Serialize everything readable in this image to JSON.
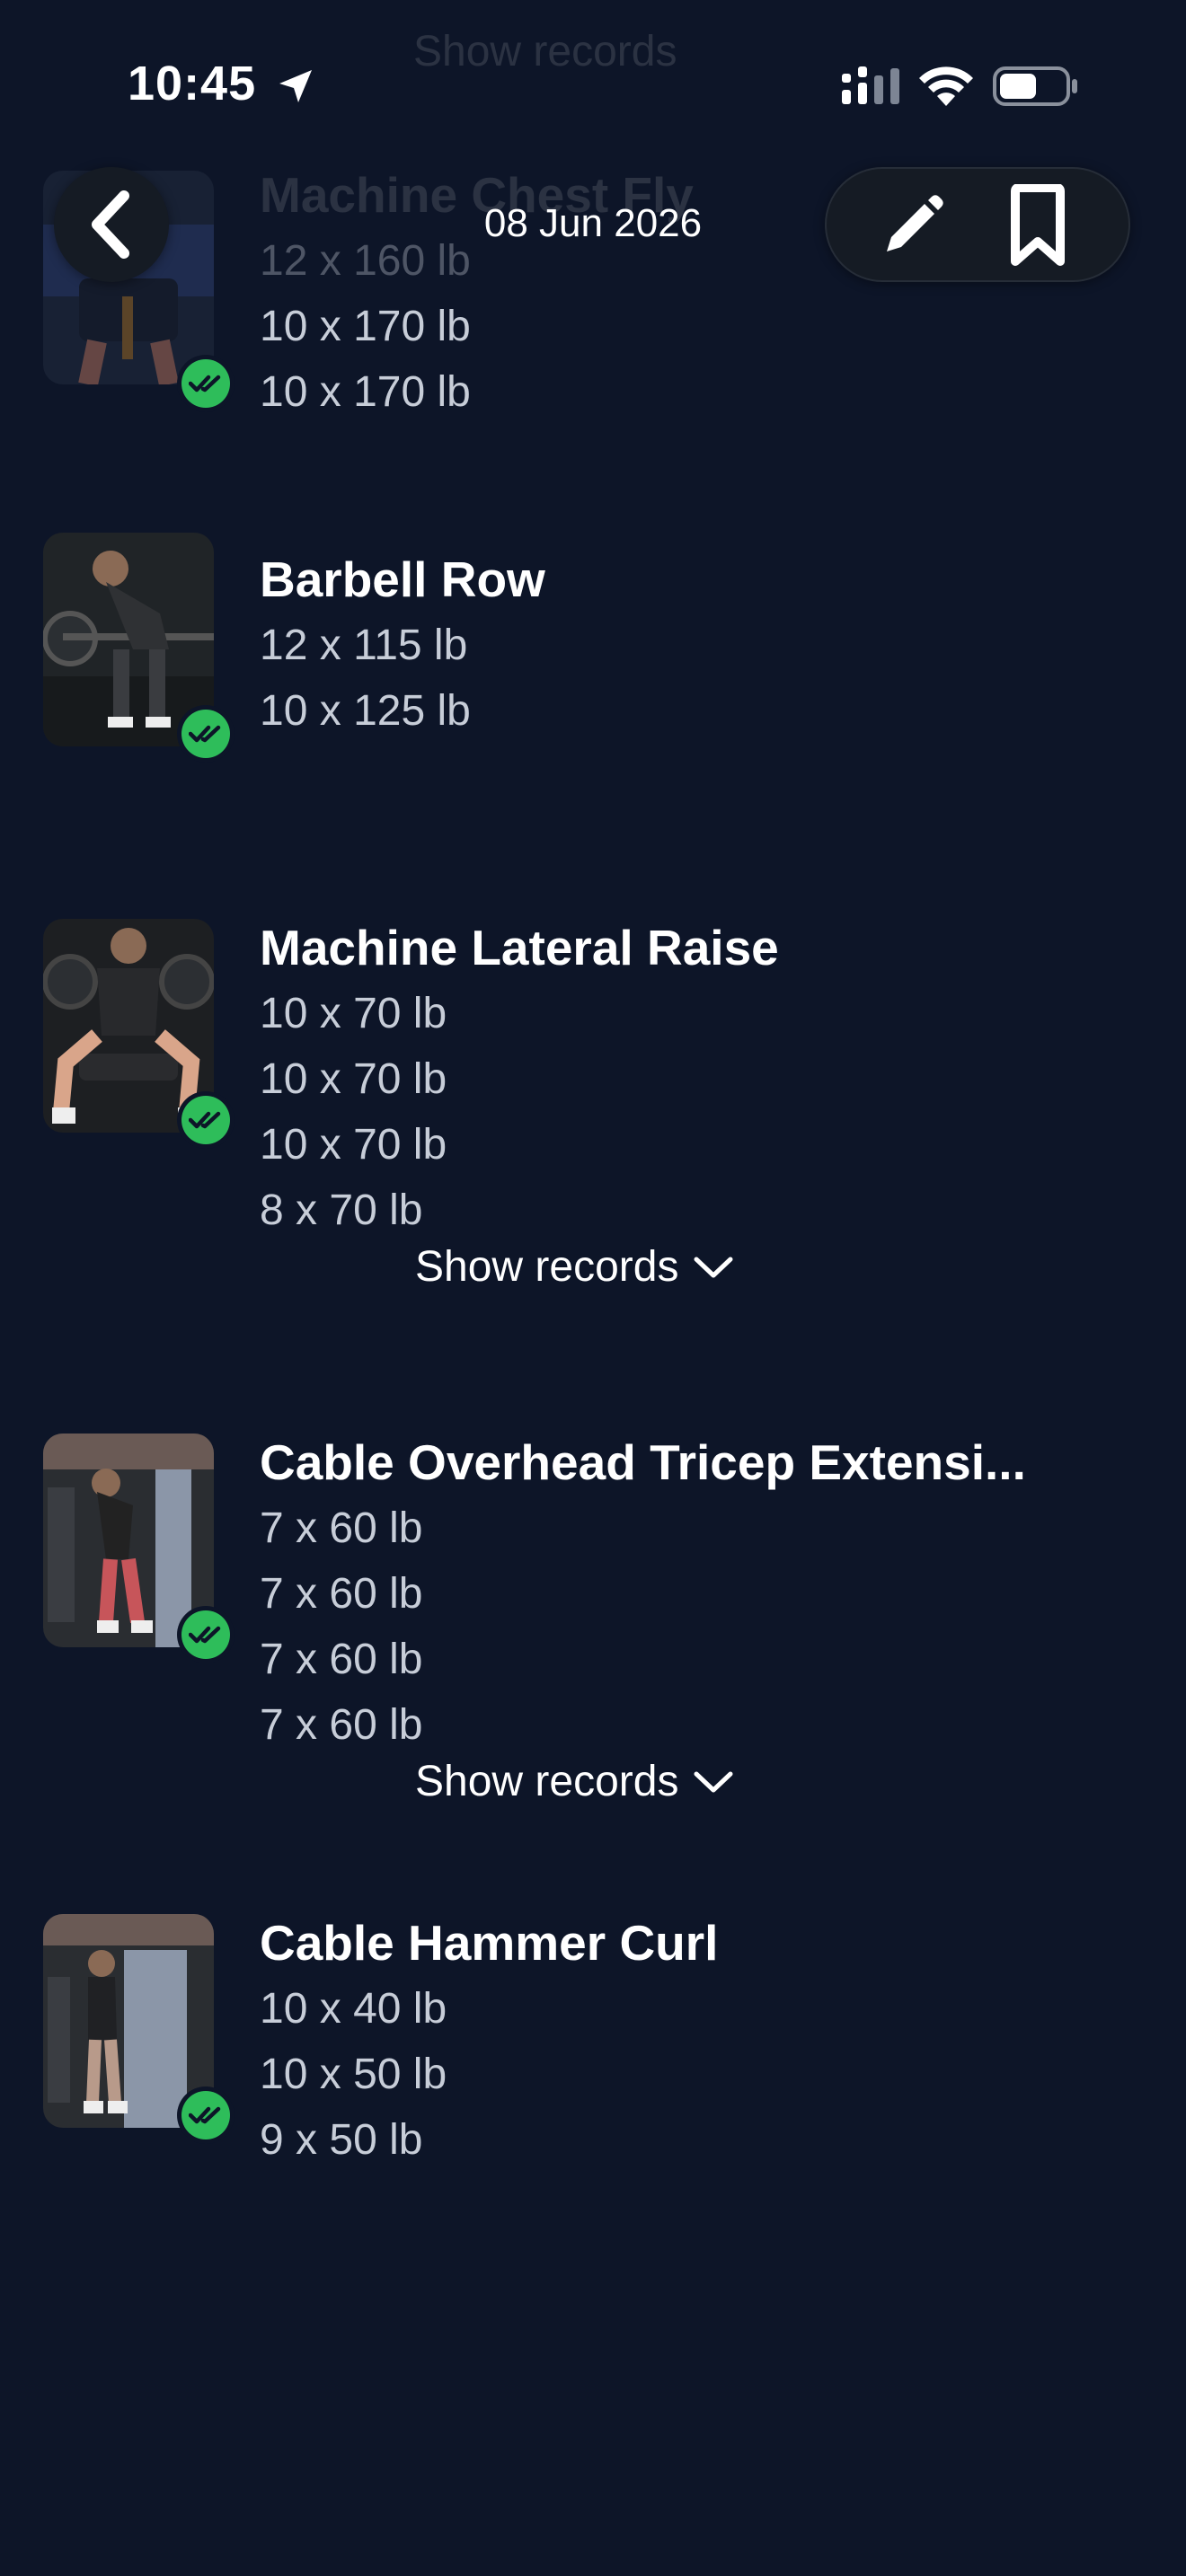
{
  "status_bar": {
    "time": "10:45"
  },
  "header": {
    "ghost_show_records": "Show records",
    "date": "08 Jun 2026"
  },
  "exercises": [
    {
      "name": "Machine Chest Fly",
      "sets": [
        "12 x 160 lb",
        "10 x 170 lb",
        "10 x 170 lb"
      ]
    },
    {
      "name": "Barbell Row",
      "sets": [
        "12 x 115 lb",
        "10 x 125 lb"
      ]
    },
    {
      "name": "Machine Lateral Raise",
      "sets": [
        "10 x 70 lb",
        "10 x 70 lb",
        "10 x 70 lb",
        "8 x 70 lb"
      ],
      "show_records": "Show records"
    },
    {
      "name": "Cable Overhead Tricep Extensi...",
      "sets": [
        "7 x 60 lb",
        "7 x 60 lb",
        "7 x 60 lb",
        "7 x 60 lb"
      ],
      "show_records": "Show records"
    },
    {
      "name": "Cable Hammer Curl",
      "sets": [
        "10 x 40 lb",
        "10 x 50 lb",
        "9 x 50 lb"
      ]
    }
  ],
  "colors": {
    "background": "#0d1528",
    "check_green": "#2ebd5a",
    "set_text": "#c7cdd8",
    "nav_button": "#151b24"
  },
  "icons": [
    "back-chevron-icon",
    "pencil-icon",
    "bookmark-icon",
    "location-arrow-icon",
    "signal-icon",
    "wifi-icon",
    "battery-icon",
    "double-check-icon",
    "chevron-down-icon"
  ]
}
